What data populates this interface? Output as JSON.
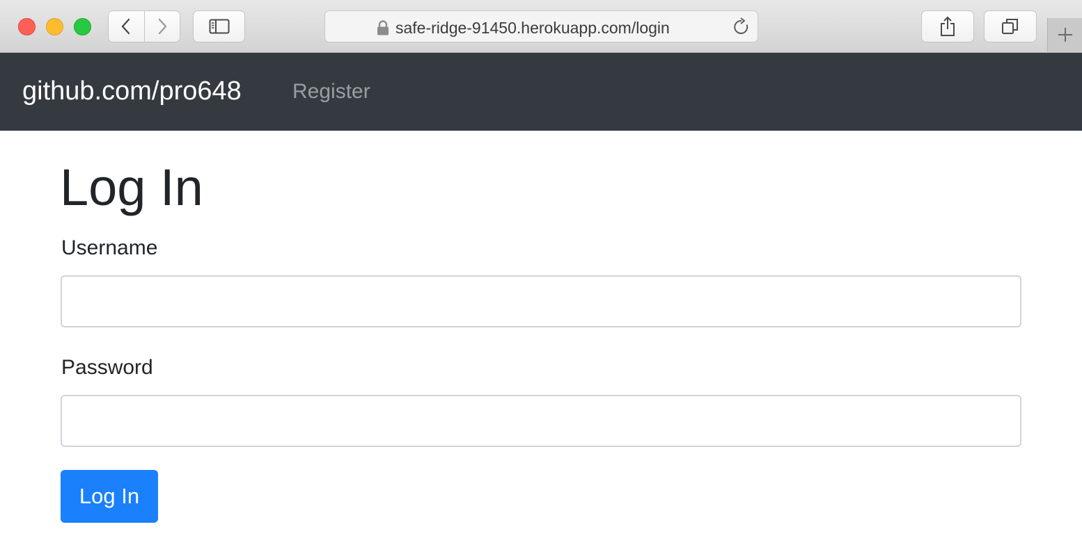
{
  "browser": {
    "url": "safe-ridge-91450.herokuapp.com/login",
    "icons": {
      "back": "chevron-left-icon",
      "forward": "chevron-right-icon",
      "sidebar": "sidebar-icon",
      "lock": "lock-icon",
      "reload": "reload-icon",
      "share": "share-icon",
      "tabs": "tabs-overview-icon",
      "new_tab": "plus-icon"
    }
  },
  "navbar": {
    "brand": "github.com/pro648",
    "links": [
      {
        "label": "Register"
      }
    ],
    "background": "#343a40"
  },
  "main": {
    "title": "Log In",
    "fields": [
      {
        "label": "Username",
        "value": "",
        "type": "text"
      },
      {
        "label": "Password",
        "value": "",
        "type": "password"
      }
    ],
    "submit_label": "Log In",
    "submit_color": "#1a80fb"
  }
}
